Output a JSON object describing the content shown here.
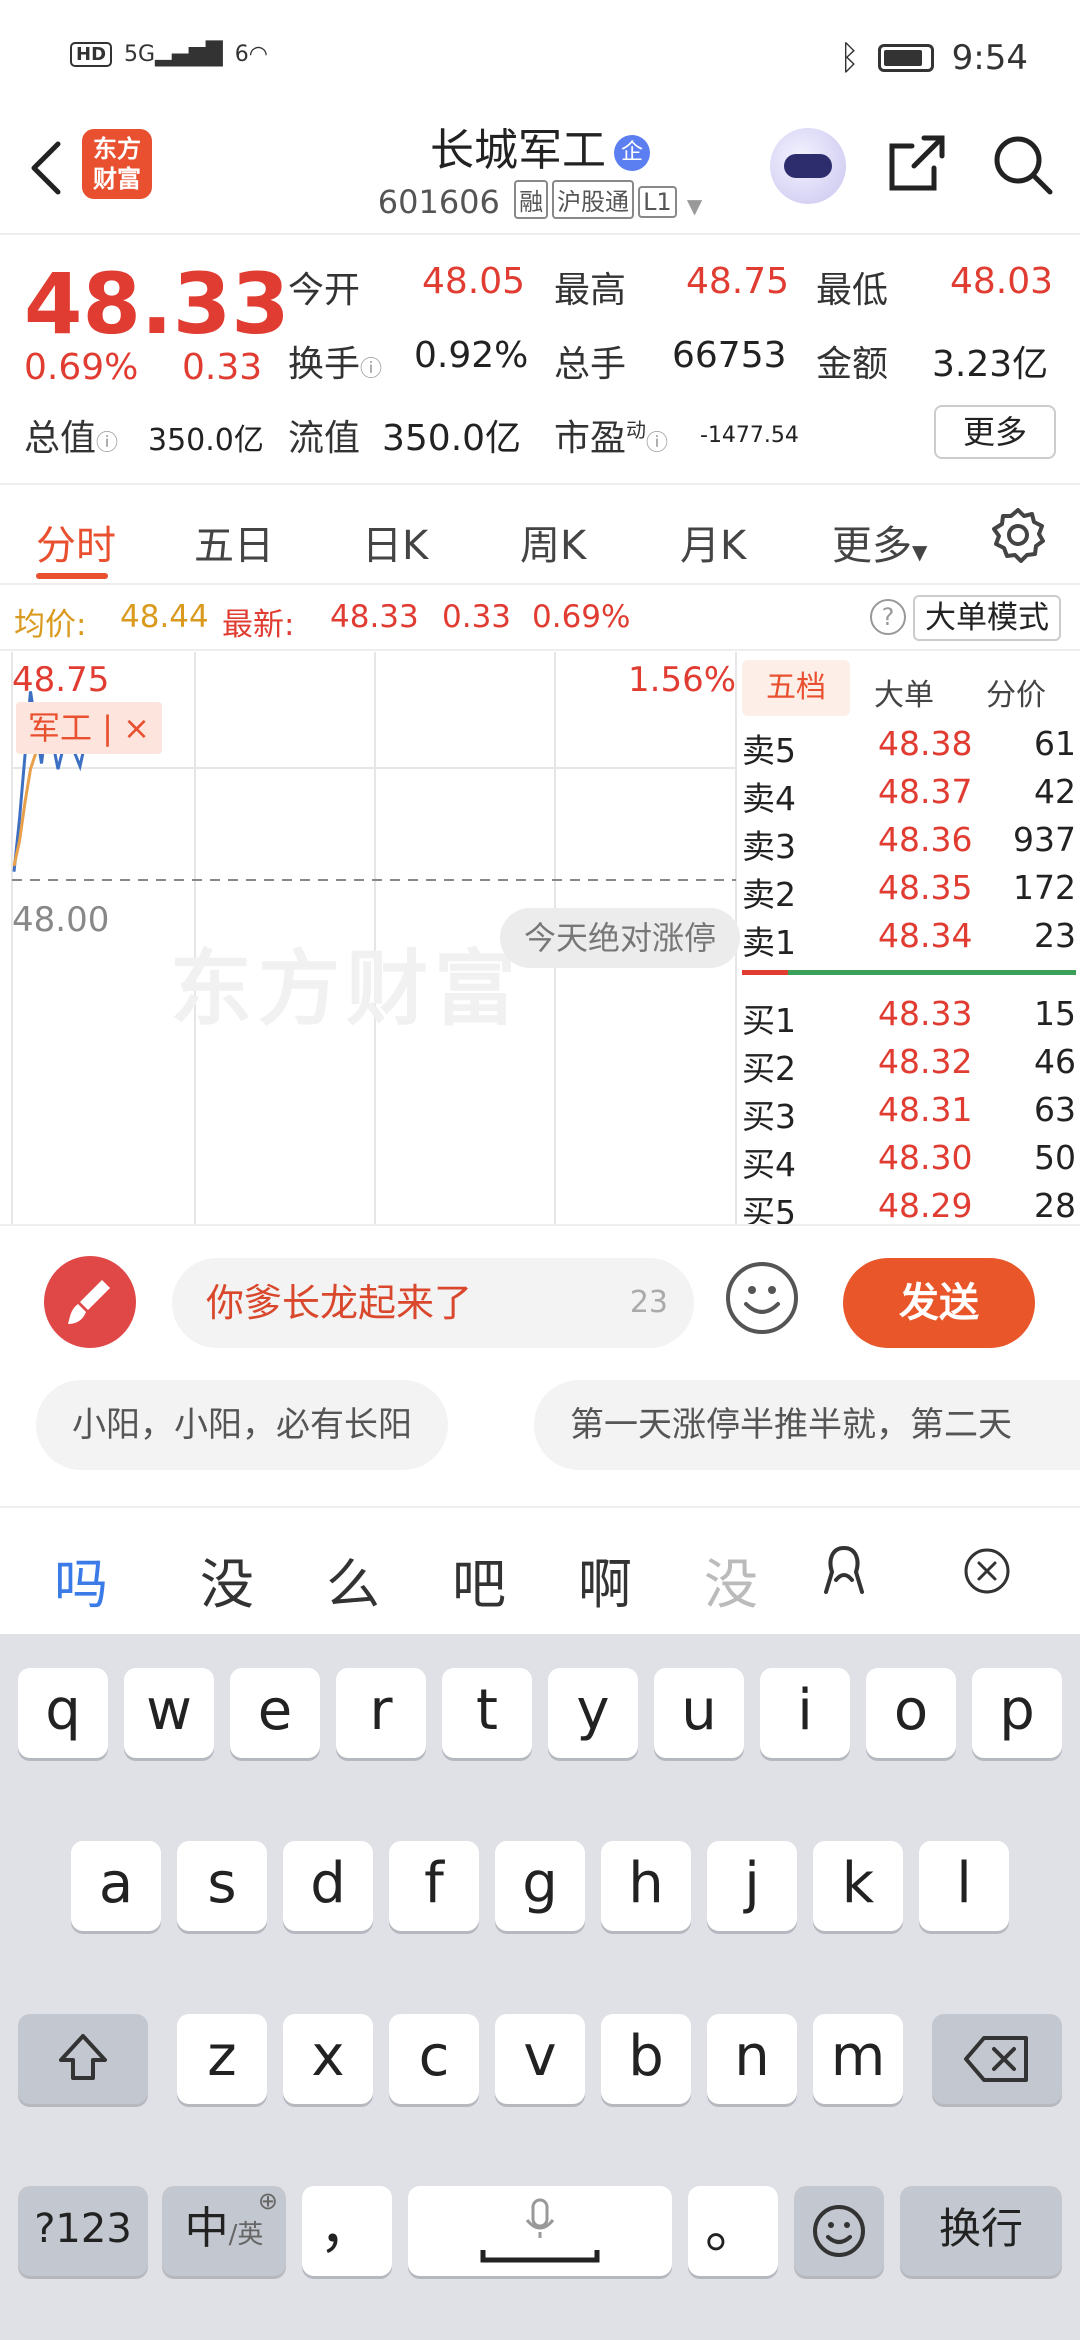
{
  "status_bar": {
    "left_hd": "HD",
    "left_5g": "5G",
    "left_wifi_num": "6",
    "time": "9:54"
  },
  "header": {
    "logo_line1": "东方",
    "logo_line2": "财富",
    "title": "长城军工",
    "title_badge": "企",
    "code": "601606",
    "tags": [
      "融",
      "沪股通",
      "L1"
    ]
  },
  "quote": {
    "price": "48.33",
    "change_pct": "0.69%",
    "change_amt": "0.33",
    "open_label": "今开",
    "open": "48.05",
    "high_label": "最高",
    "high": "48.75",
    "low_label": "最低",
    "low": "48.03",
    "turnover_label": "换手",
    "turnover": "0.92%",
    "volume_label": "总手",
    "volume": "66753",
    "amount_label": "金额",
    "amount": "3.23亿",
    "mktcap_label": "总值",
    "mktcap": "350.0亿",
    "float_label": "流值",
    "float": "350.0亿",
    "pe_label": "市盈",
    "pe_sup": "动",
    "pe": "-1477.54",
    "more": "更多"
  },
  "tabs": [
    "分时",
    "五日",
    "日K",
    "周K",
    "月K",
    "更多"
  ],
  "avgbar": {
    "avg_label": "均价:",
    "avg": "48.44",
    "latest_label": "最新:",
    "latest": "48.33",
    "chg": "0.33",
    "pct": "0.69%",
    "mode_btn": "大单模式"
  },
  "chart": {
    "top_price": "48.75",
    "top_pct": "1.56%",
    "base_price": "48.00",
    "tag_chip": "军工 | ×",
    "watermark": "东方财富",
    "bubble": "今天绝对涨停"
  },
  "chart_data": {
    "type": "line",
    "ylim": [
      48.0,
      48.75
    ],
    "series": [
      {
        "values": [
          48.03,
          48.22,
          48.45,
          48.68,
          48.55,
          48.42,
          48.58,
          48.5,
          48.4,
          48.48,
          48.52,
          48.46,
          48.41,
          48.5
        ]
      },
      {
        "values": [
          48.05,
          48.14,
          48.28,
          48.4,
          48.46,
          48.48,
          48.5,
          48.5,
          48.49,
          48.48,
          48.48,
          48.47,
          48.46,
          48.46
        ]
      }
    ],
    "colors": [
      "#3d6fc2",
      "#e8a04a"
    ]
  },
  "book": {
    "tabs": [
      "五档",
      "大单",
      "分价"
    ],
    "asks": [
      {
        "n": "卖5",
        "p": "48.38",
        "v": "61"
      },
      {
        "n": "卖4",
        "p": "48.37",
        "v": "42"
      },
      {
        "n": "卖3",
        "p": "48.36",
        "v": "937"
      },
      {
        "n": "卖2",
        "p": "48.35",
        "v": "172"
      },
      {
        "n": "卖1",
        "p": "48.34",
        "v": "23"
      }
    ],
    "bids": [
      {
        "n": "买1",
        "p": "48.33",
        "v": "15"
      },
      {
        "n": "买2",
        "p": "48.32",
        "v": "46"
      },
      {
        "n": "买3",
        "p": "48.31",
        "v": "63"
      },
      {
        "n": "买4",
        "p": "48.30",
        "v": "50"
      },
      {
        "n": "买5",
        "p": "48.29",
        "v": "28"
      }
    ]
  },
  "composer": {
    "input_text": "你爹长龙起来了",
    "count": "23",
    "send": "发送",
    "suggestions": [
      "小阳，小阳，必有长阳",
      "第一天涨停半推半就，第二天"
    ]
  },
  "candidates": [
    "吗",
    "没",
    "么",
    "吧",
    "啊",
    "没"
  ],
  "keyboard": {
    "row1": [
      "q",
      "w",
      "e",
      "r",
      "t",
      "y",
      "u",
      "i",
      "o",
      "p"
    ],
    "row2": [
      "a",
      "s",
      "d",
      "f",
      "g",
      "h",
      "j",
      "k",
      "l"
    ],
    "row3": [
      "z",
      "x",
      "c",
      "v",
      "b",
      "n",
      "m"
    ],
    "num_key": "?123",
    "lang_key_main": "中",
    "lang_key_sub": "/英",
    "comma": "，",
    "period": "。",
    "enter": "换行"
  }
}
